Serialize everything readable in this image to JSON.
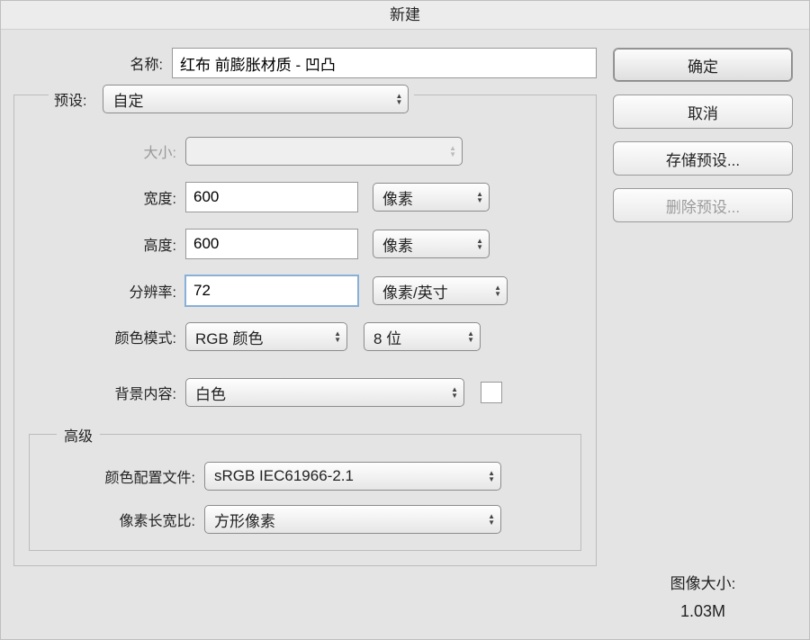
{
  "title": "新建",
  "name": {
    "label": "名称:",
    "value": "红布 前膨胀材质 - 凹凸"
  },
  "preset": {
    "label": "预设:",
    "value": "自定"
  },
  "size": {
    "label": "大小:",
    "value": ""
  },
  "width": {
    "label": "宽度:",
    "value": "600",
    "unit": "像素"
  },
  "height": {
    "label": "高度:",
    "value": "600",
    "unit": "像素"
  },
  "resolution": {
    "label": "分辨率:",
    "value": "72",
    "unit": "像素/英寸"
  },
  "colorMode": {
    "label": "颜色模式:",
    "mode": "RGB 颜色",
    "bitDepth": "8 位"
  },
  "bgContent": {
    "label": "背景内容:",
    "value": "白色",
    "swatchColor": "#ffffff"
  },
  "advanced": {
    "legend": "高级",
    "colorProfile": {
      "label": "颜色配置文件:",
      "value": "sRGB IEC61966-2.1"
    },
    "pixelAspect": {
      "label": "像素长宽比:",
      "value": "方形像素"
    }
  },
  "buttons": {
    "ok": "确定",
    "cancel": "取消",
    "savePreset": "存储预设...",
    "deletePreset": "删除预设..."
  },
  "imageSize": {
    "label": "图像大小:",
    "value": "1.03M"
  }
}
